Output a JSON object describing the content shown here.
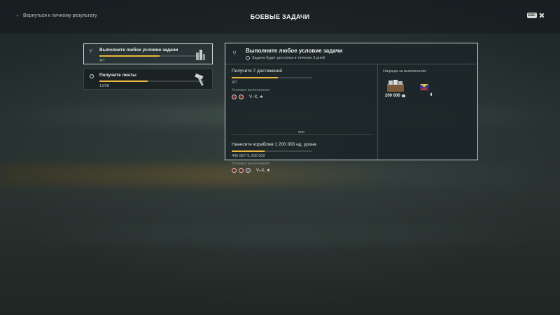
{
  "header": {
    "back_label": "Вернуться к личному результату",
    "title": "БОЕВЫЕ ЗАДАЧИ",
    "close_key": "ESC"
  },
  "tasks": [
    {
      "name": "Выполните любое условие задачи",
      "progress": "4/7",
      "fraction": 0.57,
      "active": true,
      "icon": "split-icon",
      "image": "trophy-icon"
    },
    {
      "name": "Получите ленты",
      "progress": "13/28",
      "fraction": 0.46,
      "active": false,
      "icon": "circle-icon",
      "image": "hammer-icon"
    }
  ],
  "detail": {
    "title": "Выполните любое условие задачи",
    "availability": "Задача будет доступна в течение 3 дней",
    "conditions": [
      {
        "title": "Получите 7 достижений",
        "progress": "4/7",
        "fraction": 0.57,
        "label": "Условия выполнения:",
        "tier": "V–X, ★"
      },
      {
        "title": "Нанесите кораблям 1 200 000 ед. урона",
        "progress": "495 687 /1 200 000",
        "fraction": 0.41,
        "label": "Условия выполнения:",
        "tier": "V–X, ★"
      }
    ],
    "or_label": "или",
    "reward_label": "Награда за выполнение:",
    "rewards": {
      "credits": "200 000",
      "flags": "4"
    }
  },
  "colors": {
    "accent": "#e9b83c",
    "border": "#cfd7d3"
  }
}
